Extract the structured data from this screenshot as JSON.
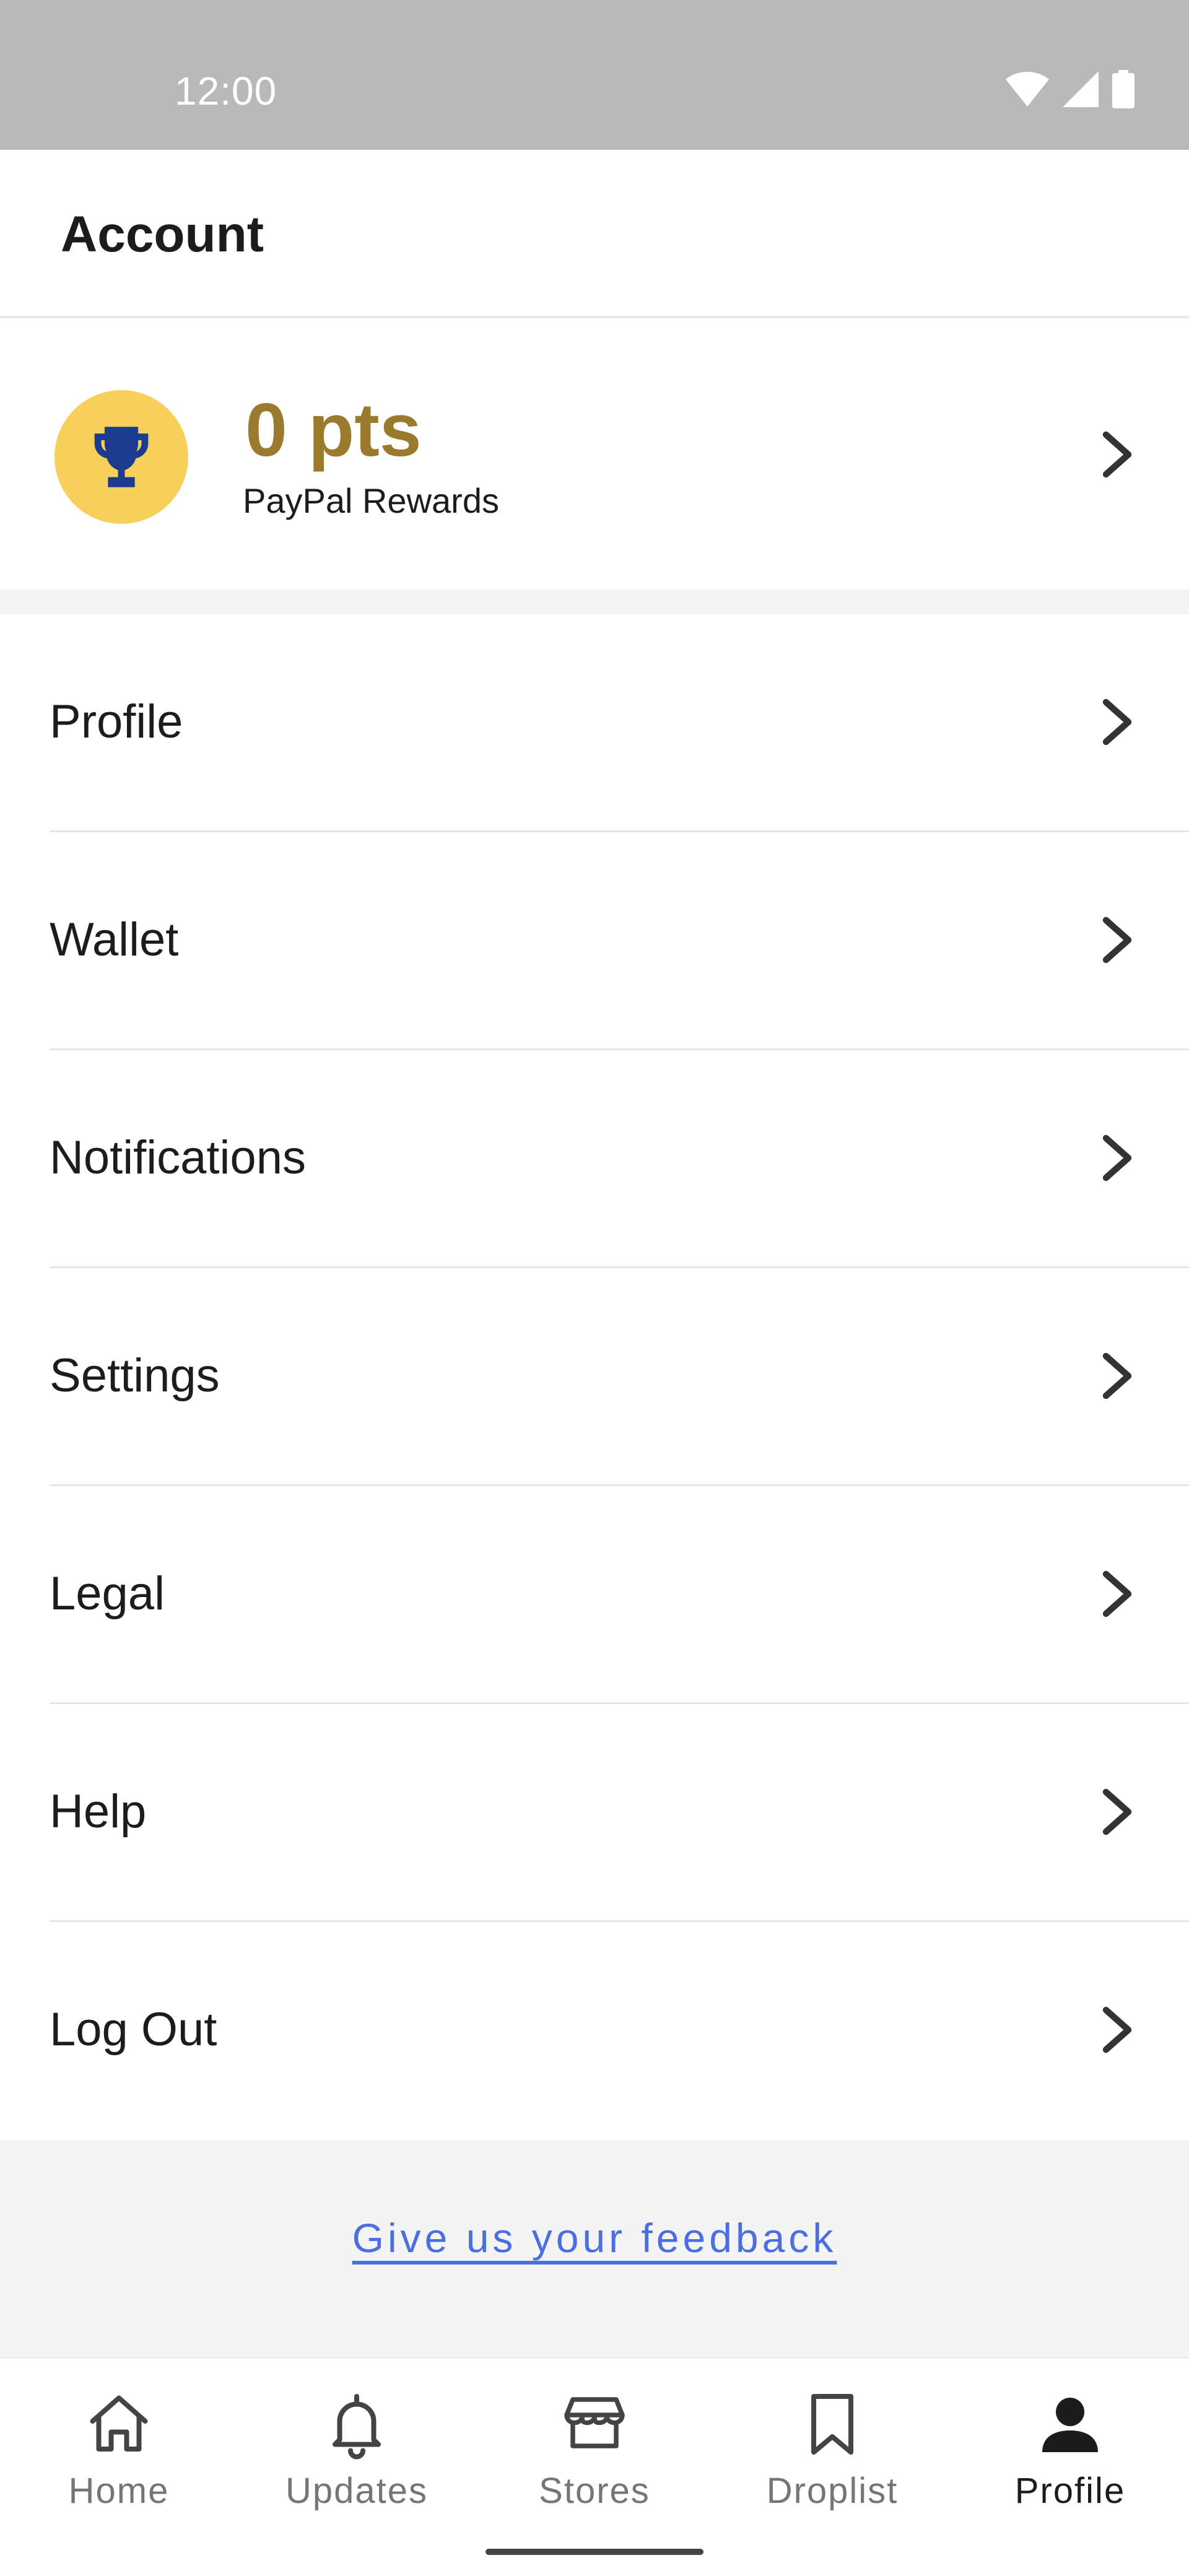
{
  "status_bar": {
    "time": "12:00",
    "icons": [
      "wifi-icon",
      "signal-icon",
      "battery-icon"
    ]
  },
  "header": {
    "title": "Account"
  },
  "rewards": {
    "points": "0 pts",
    "label": "PayPal Rewards",
    "icon": "trophy-icon",
    "colors": {
      "circle": "#f7d05c",
      "trophy": "#1b3b8f",
      "points_text": "#9a7a2c"
    }
  },
  "menu": {
    "items": [
      {
        "label": "Profile"
      },
      {
        "label": "Wallet"
      },
      {
        "label": "Notifications"
      },
      {
        "label": "Settings"
      },
      {
        "label": "Legal"
      },
      {
        "label": "Help"
      },
      {
        "label": "Log Out"
      }
    ]
  },
  "feedback": {
    "link_text": "Give us your feedback",
    "color": "#4b6fe0"
  },
  "bottom_nav": {
    "items": [
      {
        "label": "Home",
        "icon": "home-icon"
      },
      {
        "label": "Updates",
        "icon": "bell-icon"
      },
      {
        "label": "Stores",
        "icon": "store-icon"
      },
      {
        "label": "Droplist",
        "icon": "bookmark-icon"
      },
      {
        "label": "Profile",
        "icon": "person-icon"
      }
    ],
    "active": "Profile"
  }
}
